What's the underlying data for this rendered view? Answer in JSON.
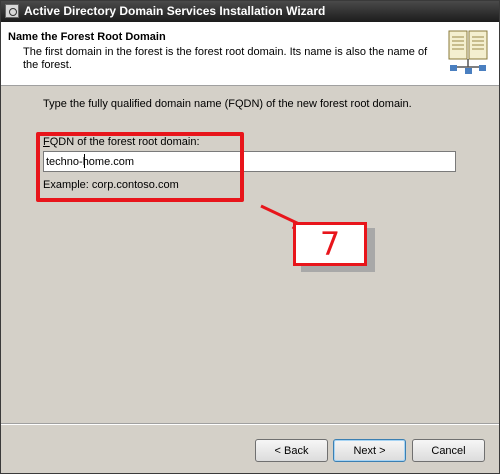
{
  "window": {
    "title": "Active Directory Domain Services Installation Wizard"
  },
  "header": {
    "title": "Name the Forest Root Domain",
    "description": "The first domain in the forest is the forest root domain. Its name is also the name of the forest."
  },
  "content": {
    "instruction": "Type the fully qualified domain name (FQDN) of the new forest root domain.",
    "field_label_prefix": "F",
    "field_label_rest": "QDN of the forest root domain:",
    "field_value": "techno-home.com",
    "example": "Example: corp.contoso.com"
  },
  "annotation": {
    "step_number": "7",
    "color": "#e8151b"
  },
  "buttons": {
    "back": "< Back",
    "next": "Next >",
    "cancel": "Cancel"
  },
  "icons": {
    "window": "app-icon",
    "header": "book-icon"
  }
}
